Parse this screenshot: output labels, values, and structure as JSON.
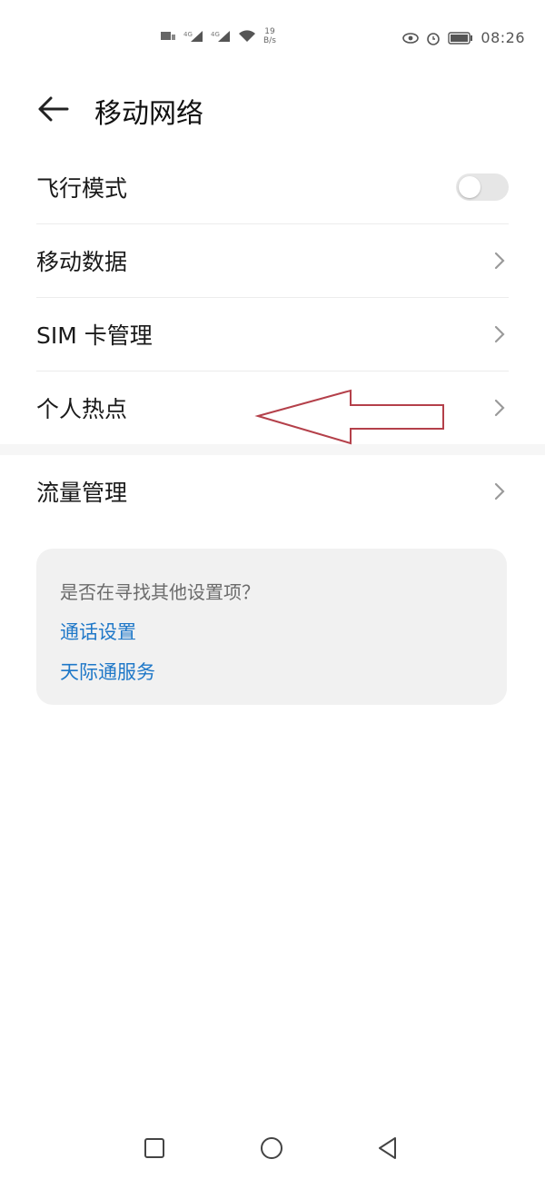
{
  "status_bar": {
    "time": "08:26",
    "net_speed_value": "19",
    "net_speed_unit": "B/s",
    "icons": [
      "sim-icon",
      "signal-icon",
      "signal-icon",
      "wifi-icon",
      "eye-icon",
      "alarm-icon",
      "battery-icon"
    ]
  },
  "header": {
    "back_icon": "arrow-left-icon",
    "title": "移动网络"
  },
  "settings": {
    "airplane_mode": {
      "label": "飞行模式",
      "enabled": false
    },
    "mobile_data": {
      "label": "移动数据"
    },
    "sim_management": {
      "label": "SIM 卡管理"
    },
    "hotspot": {
      "label": "个人热点"
    },
    "data_usage": {
      "label": "流量管理"
    }
  },
  "suggestion": {
    "question": "是否在寻找其他设置项？",
    "links": [
      "通话设置",
      "天际通服务"
    ]
  },
  "navigation": {
    "icons": [
      "recent-apps-icon",
      "home-icon",
      "back-triangle-icon"
    ]
  },
  "colors": {
    "link": "#1f78c8",
    "annotation": "#b4404a",
    "toggle_off": "#e6e6e6",
    "card_bg": "#f1f1f1"
  }
}
